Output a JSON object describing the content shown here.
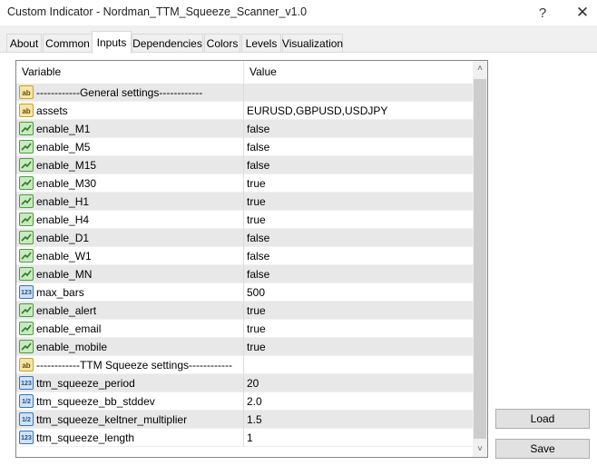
{
  "window": {
    "title": "Custom Indicator - Nordman_TTM_Squeeze_Scanner_v1.0",
    "help_glyph": "?",
    "close_glyph": "✕"
  },
  "tabs": [
    {
      "label": "About",
      "active": false
    },
    {
      "label": "Common",
      "active": false
    },
    {
      "label": "Inputs",
      "active": true
    },
    {
      "label": "Dependencies",
      "active": false
    },
    {
      "label": "Colors",
      "active": false
    },
    {
      "label": "Levels",
      "active": false
    },
    {
      "label": "Visualization",
      "active": false
    }
  ],
  "grid": {
    "col_variable": "Variable",
    "col_value": "Value",
    "rows": [
      {
        "icon": "string-icon",
        "icon_text": "ab",
        "name": "------------General settings------------",
        "value": "",
        "shade": true
      },
      {
        "icon": "string-icon",
        "icon_text": "ab",
        "name": "assets",
        "value": "EURUSD,GBPUSD,USDJPY",
        "shade": false
      },
      {
        "icon": "bool-icon",
        "icon_text": "",
        "name": "enable_M1",
        "value": "false",
        "shade": true
      },
      {
        "icon": "bool-icon",
        "icon_text": "",
        "name": "enable_M5",
        "value": "false",
        "shade": false
      },
      {
        "icon": "bool-icon",
        "icon_text": "",
        "name": "enable_M15",
        "value": "false",
        "shade": true
      },
      {
        "icon": "bool-icon",
        "icon_text": "",
        "name": "enable_M30",
        "value": "true",
        "shade": false
      },
      {
        "icon": "bool-icon",
        "icon_text": "",
        "name": "enable_H1",
        "value": "true",
        "shade": true
      },
      {
        "icon": "bool-icon",
        "icon_text": "",
        "name": "enable_H4",
        "value": "true",
        "shade": false
      },
      {
        "icon": "bool-icon",
        "icon_text": "",
        "name": "enable_D1",
        "value": "false",
        "shade": true
      },
      {
        "icon": "bool-icon",
        "icon_text": "",
        "name": "enable_W1",
        "value": "false",
        "shade": false
      },
      {
        "icon": "bool-icon",
        "icon_text": "",
        "name": "enable_MN",
        "value": "false",
        "shade": true
      },
      {
        "icon": "int-icon",
        "icon_text": "123",
        "name": "max_bars",
        "value": "500",
        "shade": false
      },
      {
        "icon": "bool-icon",
        "icon_text": "",
        "name": "enable_alert",
        "value": "true",
        "shade": true
      },
      {
        "icon": "bool-icon",
        "icon_text": "",
        "name": "enable_email",
        "value": "true",
        "shade": false
      },
      {
        "icon": "bool-icon",
        "icon_text": "",
        "name": "enable_mobile",
        "value": "true",
        "shade": true
      },
      {
        "icon": "string-icon",
        "icon_text": "ab",
        "name": "------------TTM Squeeze settings------------",
        "value": "",
        "shade": false
      },
      {
        "icon": "int-icon",
        "icon_text": "123",
        "name": "ttm_squeeze_period",
        "value": "20",
        "shade": true
      },
      {
        "icon": "double-icon",
        "icon_text": "1/2",
        "name": "ttm_squeeze_bb_stddev",
        "value": "2.0",
        "shade": false
      },
      {
        "icon": "double-icon",
        "icon_text": "1/2",
        "name": "ttm_squeeze_keltner_multiplier",
        "value": "1.5",
        "shade": true
      },
      {
        "icon": "int-icon",
        "icon_text": "123",
        "name": "ttm_squeeze_length",
        "value": "1",
        "shade": false
      }
    ]
  },
  "buttons": {
    "load": "Load",
    "save": "Save"
  },
  "scrollbar": {
    "up_glyph": "˄",
    "down_glyph": "˅"
  }
}
